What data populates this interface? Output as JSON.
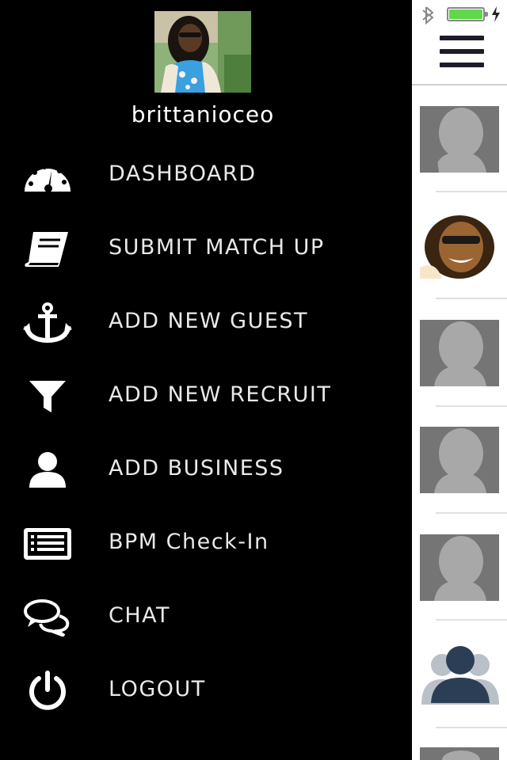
{
  "drawer": {
    "username": "brittanioceo",
    "menu": [
      {
        "label": "DASHBOARD",
        "icon": "dashboard-gauge-icon"
      },
      {
        "label": "SUBMIT MATCH UP",
        "icon": "book-icon"
      },
      {
        "label": "ADD NEW GUEST",
        "icon": "anchor-icon"
      },
      {
        "label": "ADD NEW RECRUIT",
        "icon": "filter-icon"
      },
      {
        "label": "ADD BUSINESS",
        "icon": "user-icon"
      },
      {
        "label": "BPM Check-In",
        "icon": "list-card-icon"
      },
      {
        "label": "CHAT",
        "icon": "chat-bubbles-icon"
      },
      {
        "label": "LOGOUT",
        "icon": "power-icon"
      }
    ]
  },
  "status_bar": {
    "battery_color": "#5fd84a"
  },
  "colors": {
    "drawer_bg": "#000000",
    "panel_bg": "#ffffff",
    "placeholder_gray": "#757575",
    "group_icon_navy": "#2c3e55"
  }
}
